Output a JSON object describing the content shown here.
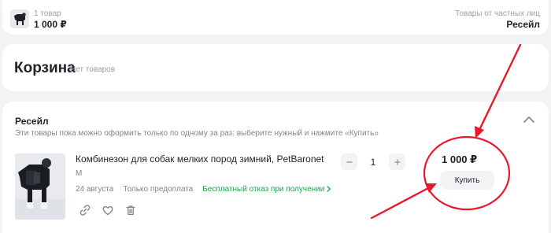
{
  "summary": {
    "count_label": "1 товар",
    "total": "1 000 ₽",
    "seller_note": "Товары от частных лиц",
    "seller_type": "Ресейл"
  },
  "cart": {
    "title": "Корзина",
    "empty_label": "Нет товаров"
  },
  "resale": {
    "title": "Ресейл",
    "hint": "Эти товары пока можно оформить только по одному за раз: выберите нужный и нажмите «Купить»",
    "collapse_icon": "chevron-up-icon",
    "item": {
      "name": "Комбинезон для собак мелких пород зимний, PetBaronet",
      "size": "M",
      "delivery_date": "24 августа",
      "payment": "Только предоплата",
      "return_policy": "Бесплатный отказ при получении",
      "quantity": "1",
      "price": "1 000 ₽",
      "buy_label": "Купить",
      "actions": [
        "link-icon",
        "heart-icon",
        "trash-icon"
      ]
    }
  },
  "annotation": {
    "color": "#e8192c"
  }
}
